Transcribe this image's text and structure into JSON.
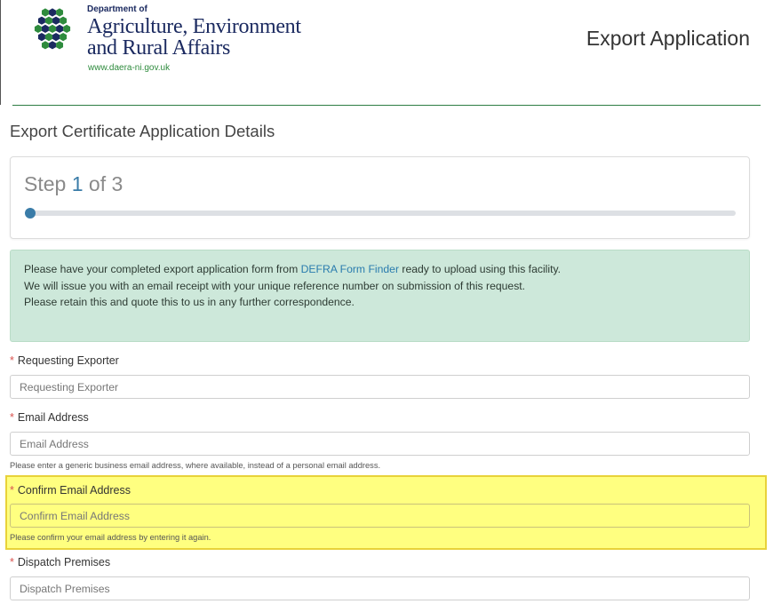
{
  "header": {
    "logo": {
      "dept_of": "Department of",
      "line1": "Agriculture, Environment",
      "line2": "and Rural Affairs",
      "url": "www.daera-ni.gov.uk",
      "mark_colors": [
        "#1b2a60",
        "#2e8b3d"
      ]
    },
    "app_title": "Export Application"
  },
  "page": {
    "heading": "Export Certificate Application Details"
  },
  "step": {
    "prefix": "Step ",
    "current": "1",
    "suffix": " of 3",
    "progress_fraction": 0.0
  },
  "info": {
    "line1_before": "Please have your completed export application form from ",
    "line1_link": "DEFRA Form Finder",
    "line1_after": " ready to upload using this facility.",
    "line2": "We will issue you with an email receipt with your unique reference number on submission of this request.",
    "line3": "Please retain this and quote this to us in any further correspondence."
  },
  "form": {
    "required_marker": "*",
    "requesting_exporter": {
      "label": "Requesting Exporter",
      "placeholder": "Requesting Exporter",
      "value": ""
    },
    "email": {
      "label": "Email Address",
      "placeholder": "Email Address",
      "value": "",
      "help": "Please enter a generic business email address, where available, instead of a personal email address."
    },
    "confirm_email": {
      "label": "Confirm Email Address",
      "placeholder": "Confirm Email Address",
      "value": "",
      "help": "Please confirm your email address by entering it again."
    },
    "dispatch_premises": {
      "label": "Dispatch Premises",
      "placeholder": "Dispatch Premises",
      "value": ""
    }
  },
  "colors": {
    "accent": "#3a7ca8",
    "header_rule": "#2e7d43",
    "info_bg": "#cde8da",
    "highlight": "#ffff80",
    "required": "#d9534f"
  }
}
